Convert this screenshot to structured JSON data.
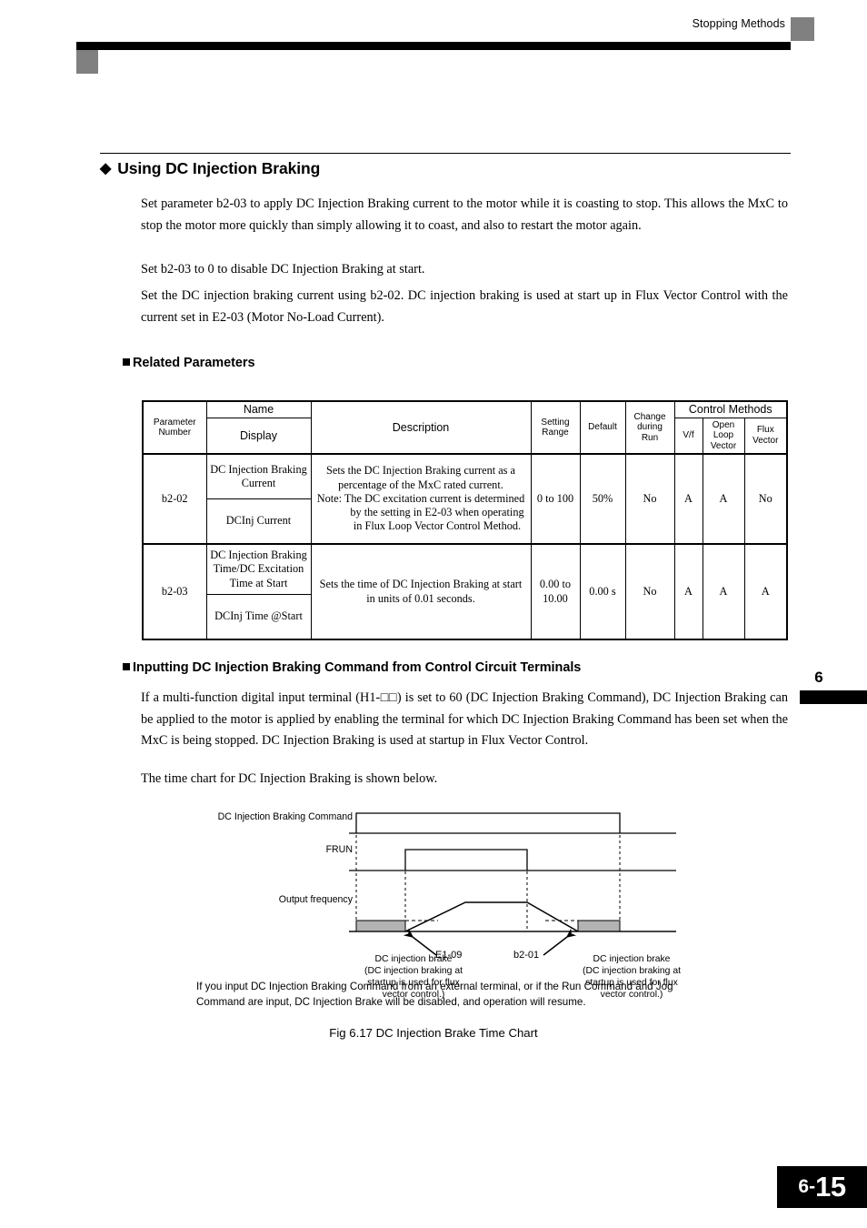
{
  "header": {
    "running_title": "Stopping Methods"
  },
  "chapter_tab": {
    "number": "6"
  },
  "footer": {
    "chapter": "6-",
    "page": "15"
  },
  "section": {
    "diamond_glyph": "◆",
    "title": "Using DC Injection Braking",
    "paragraphs": [
      "Set parameter b2-03 to apply DC Injection Braking current to the motor while it is coasting to stop. This allows the MxC to stop the motor more quickly than simply allowing it to coast, and also to restart the motor again.",
      "Set b2-03 to 0 to disable DC Injection Braking at start.",
      "Set the DC injection braking current using b2-02. DC injection braking is used at start up in Flux Vector Control with the current set in E2-03 (Motor No-Load Current)."
    ]
  },
  "related_parameters": {
    "heading": "Related Parameters",
    "table": {
      "headers": {
        "parameter_number": "Parameter Number",
        "name": "Name",
        "display": "Display",
        "description": "Description",
        "setting_range": "Setting Range",
        "default": "Default",
        "change_during_run": "Change during Run",
        "control_methods": "Control Methods",
        "vf": "V/f",
        "open_loop_vector": "Open Loop Vector",
        "flux_vector": "Flux Vector"
      },
      "rows": [
        {
          "number": "b2-02",
          "name": "DC Injection Braking Current",
          "display": "DCInj Current",
          "description_line1": "Sets the DC Injection Braking current as a percentage of the MxC rated current.",
          "description_note_label": "Note:",
          "description_note_body": "The DC excitation current is determined by the setting in E2-03 when operating in Flux Loop Vector Control Method.",
          "setting_range": "0 to 100",
          "default": "50%",
          "change_during_run": "No",
          "vf": "A",
          "open_loop_vector": "A",
          "flux_vector": "No"
        },
        {
          "number": "b2-03",
          "name": "DC Injection Braking Time/DC Excitation Time at Start",
          "display": "DCInj Time @Start",
          "description_line1": "Sets the time of DC Injection Braking at start in units of 0.01 seconds.",
          "description_note_label": "",
          "description_note_body": "",
          "setting_range": "0.00 to 10.00",
          "default": "0.00 s",
          "change_during_run": "No",
          "vf": "A",
          "open_loop_vector": "A",
          "flux_vector": "A"
        }
      ]
    }
  },
  "inputting_section": {
    "heading": "Inputting DC Injection Braking Command from Control Circuit Terminals",
    "paragraph1": "If a multi-function digital input terminal (H1-□□) is set to 60 (DC Injection Braking Command), DC Injection Braking can be applied to the motor is applied by enabling the terminal for which DC Injection Braking Command has been set when the MxC is being stopped. DC Injection Braking is used at startup in Flux Vector Control.",
    "paragraph2": "The time chart for DC Injection Braking is shown below."
  },
  "figure": {
    "signal_labels": {
      "command": "DC Injection Braking Command",
      "frun": "FRUN",
      "output_frequency": "Output frequency"
    },
    "annotations": {
      "left_param": "E1-09",
      "right_param": "b2-01",
      "left_caption_line1": "DC injection brake",
      "left_caption_line2": "(DC injection braking at",
      "left_caption_line3": "startup is used for flux",
      "left_caption_line4": "vector control.)",
      "right_caption_line1": "DC injection brake",
      "right_caption_line2": "(DC injection braking at",
      "right_caption_line3": "startup is used for flux",
      "right_caption_line4": "vector control.)"
    },
    "note": "If you input DC Injection Braking Command from an external terminal, or if the Run Command and Jog Command are input, DC Injection Brake will be disabled, and operation will resume.",
    "caption": "Fig 6.17  DC Injection Brake Time Chart"
  }
}
